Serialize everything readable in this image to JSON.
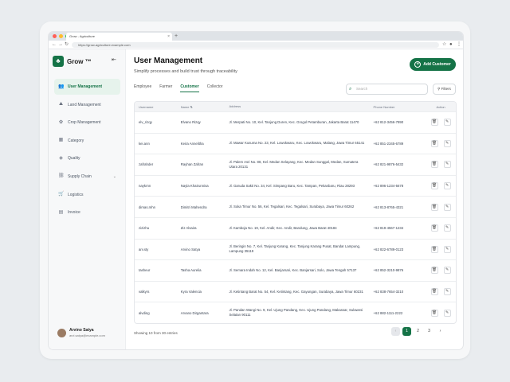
{
  "browser": {
    "tab_title": "Grow - Agriculture",
    "tab_close": "×",
    "new_tab": "+",
    "url": "https://grow-agriculture.example.com"
  },
  "sidebar": {
    "logo": "Grow ™",
    "items": [
      {
        "label": "User Management",
        "icon": "users-icon",
        "glyph": "👥",
        "active": true
      },
      {
        "label": "Land Management",
        "icon": "land-icon",
        "glyph": "⛰",
        "active": false
      },
      {
        "label": "Crop Management",
        "icon": "crop-icon",
        "glyph": "✿",
        "active": false
      },
      {
        "label": "Category",
        "icon": "category-icon",
        "glyph": "▦",
        "active": false
      },
      {
        "label": "Quality",
        "icon": "quality-icon",
        "glyph": "◈",
        "active": false
      },
      {
        "label": "Supply Chain",
        "icon": "supply-chain-icon",
        "glyph": "⛓",
        "active": false
      },
      {
        "label": "Logistics",
        "icon": "logistics-icon",
        "glyph": "🛒",
        "active": false
      },
      {
        "label": "Invoice",
        "icon": "invoice-icon",
        "glyph": "▤",
        "active": false
      }
    ],
    "user": {
      "name": "Arvino Satya",
      "email": "arvi.satya@example.com"
    }
  },
  "main": {
    "title": "User Management",
    "subtitle": "Simplify processes and build trust through traceability",
    "add_button": "Add Customer",
    "tabs": [
      {
        "label": "Employee",
        "active": false
      },
      {
        "label": "Farmer",
        "active": false
      },
      {
        "label": "Customer",
        "active": true
      },
      {
        "label": "Collector",
        "active": false
      }
    ],
    "search_placeholder": "Search",
    "filter_label": "Filters",
    "columns": [
      "Username",
      "Name",
      "Address",
      "Phone Number",
      "Action"
    ],
    "sort_icon": "⇅",
    "rows": [
      {
        "username": "elv_rizqy",
        "name": "Elvano Rizqy",
        "address": "Jl. Merpati No. 10, Kel. Tanjung Duren, Kec. Grogol Petamburan, Jakarta Barat 11470",
        "phone": "+62 812-3456-7890"
      },
      {
        "username": "kei.ann",
        "name": "Keira Annelitha",
        "address": "Jl. Mawar Kusuma No. 23, Kel. Lowokwaru, Kec. Lowokwaru, Malang, Jawa Timur 65141",
        "phone": "+62 851-2345-6789"
      },
      {
        "username": "zafrahder",
        "name": "Rayhan Zafran",
        "address": "Jl. Palem Asri No. 88, Kel. Medan Selayang, Kec. Medan Sunggal, Medan, Sumatera Utara 20131",
        "phone": "+62 821-9876-5432"
      },
      {
        "username": "naykrnn",
        "name": "Nayla Khairunnisa",
        "address": "Jl. Garuda Sakti No. 34, Kel. Simpang Baru, Kec. Tampan, Pekanbaru, Riau 28293",
        "phone": "+62 896-1234-5678"
      },
      {
        "username": "dimas.mhn",
        "name": "Dimitri Mahendra",
        "address": "Jl. Soka Timur No. 56, Kel. Tegalsari, Kec. Tegalsari, Surabaya, Jawa Timur 60262",
        "phone": "+62 813-8765-4321"
      },
      {
        "username": "zizizhu",
        "name": "Ziz Alsaira",
        "address": "Jl. Kamboja No. 19, Kel. Andir, Kec. Andir, Bandung, Jawa Barat 40184",
        "phone": "+62 819-4567-1234"
      },
      {
        "username": "arv.sty",
        "name": "Arvino Satya",
        "address": "Jl. Beringin No. 7, Kel. Tanjung Karang, Kec. Tanjung Karang Pusat, Bandar Lampung, Lampung 35119",
        "phone": "+62 822-6789-0123"
      },
      {
        "username": "tasheur",
        "name": "Tasha Aurelia",
        "address": "Jl. Semara Indah No. 12, Kel. Banjarsari, Kec. Banjarsari, Solo, Jawa Tengah 57137",
        "phone": "+62 852-3210-9876"
      },
      {
        "username": "valkyrs",
        "name": "Kyra Valencia",
        "address": "Jl. Ketintang Barat No. 54, Kel. Ketintang, Kec. Gayungan, Surabaya, Jawa Timur 60231",
        "phone": "+62 838-7654-3210"
      },
      {
        "username": "alvding",
        "name": "Arvano Dirgantara",
        "address": "Jl. Pandan Wangi No. 9, Kel. Ujung Pandang, Kec. Ujung Pandang, Makassar, Sulawesi Selatan 90111",
        "phone": "+62 882-1111-2222"
      }
    ],
    "footer": "Showing 10 from 30 entries",
    "pages": [
      "‹",
      "1",
      "2",
      "3",
      "›"
    ]
  },
  "colors": {
    "accent": "#157347",
    "active_bg": "#e6f3ec"
  }
}
